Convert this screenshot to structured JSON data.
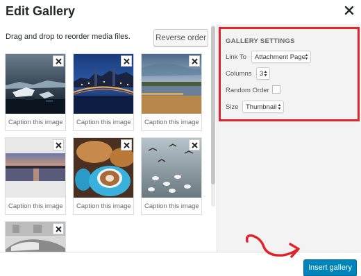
{
  "header": {
    "title": "Edit Gallery"
  },
  "main": {
    "hint": "Drag and drop to reorder media files.",
    "reverse_label": "Reverse order",
    "caption_placeholder": "Caption this image"
  },
  "settings": {
    "title": "GALLERY SETTINGS",
    "link_to_label": "Link To",
    "link_to_value": "Attachment Page",
    "columns_label": "Columns",
    "columns_value": "3",
    "random_order_label": "Random Order",
    "random_order_checked": false,
    "size_label": "Size",
    "size_value": "Thumbnail"
  },
  "footer": {
    "insert_label": "Insert gallery"
  },
  "images": [
    {
      "subject": "iceberg-boats"
    },
    {
      "subject": "bridge-city-night"
    },
    {
      "subject": "pier-coast"
    },
    {
      "subject": "lake-sunset"
    },
    {
      "subject": "coffee-pastries"
    },
    {
      "subject": "seagulls-water"
    },
    {
      "subject": "vintage-car"
    }
  ],
  "colors": {
    "accent": "#0085ba",
    "highlight": "#e0242b"
  }
}
